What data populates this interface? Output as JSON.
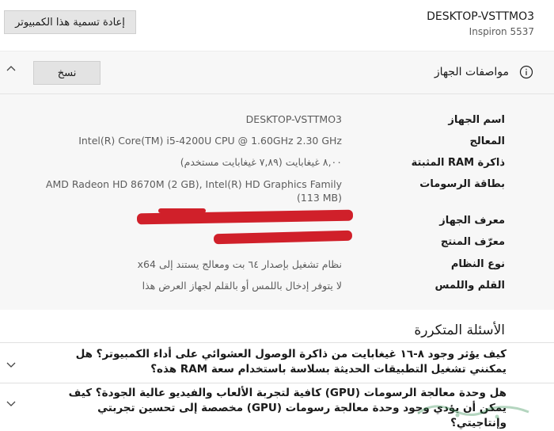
{
  "header": {
    "device_name": "DESKTOP-VSTTMO3",
    "device_model": "Inspiron 5537",
    "rename_button": "إعادة تسمية هذا الكمبيوتر"
  },
  "specs": {
    "title": "مواصفات الجهاز",
    "copy_button": "نسخ",
    "rows": [
      {
        "label": "اسم الجهاز",
        "value": "DESKTOP-VSTTMO3"
      },
      {
        "label": "المعالج",
        "value": "Intel(R) Core(TM) i5-4200U CPU @ 1.60GHz   2.30 GHz"
      },
      {
        "label": "ذاكرة RAM المثبتة",
        "value": "٨,٠٠ غيغابايت (٧,٨٩ غيغابايت مستخدم)"
      },
      {
        "label": "بطاقة الرسومات",
        "value": "AMD Radeon HD 8670M (2 GB), Intel(R) HD Graphics Family (113 MB)"
      },
      {
        "label": "معرف الجهاز",
        "value": ""
      },
      {
        "label": "معرّف المنتج",
        "value": ""
      },
      {
        "label": "نوع النظام",
        "value": "نظام تشغيل بإصدار ٦٤ بت ومعالج يستند إلى x64"
      },
      {
        "label": "القلم واللمس",
        "value": "لا يتوفر إدخال باللمس أو بالقلم لجهاز العرض هذا"
      }
    ]
  },
  "faq": {
    "title": "الأسئلة المتكررة",
    "items": [
      {
        "question": "كيف يؤثر وجود ٨-١٦ غيغابايت من ذاكرة الوصول العشوائي على أداء الكمبيوتر؟ هل يمكنني تشغيل التطبيقات الحديثة بسلاسة باستخدام سعة RAM هذه؟"
      },
      {
        "question": "هل وحدة معالجة الرسومات (GPU) كافية لتجربة الألعاب والفيديو عالية الجودة؟ كيف يمكن أن يؤدي وجود وحدة معالجة رسومات (GPU) مخصصة إلى تحسين تجربتي وإنتاجيتي؟"
      }
    ]
  },
  "colors": {
    "redaction": "#d0202a",
    "card_bg": "#f7f7f7",
    "button_bg": "#e5e5e5"
  }
}
